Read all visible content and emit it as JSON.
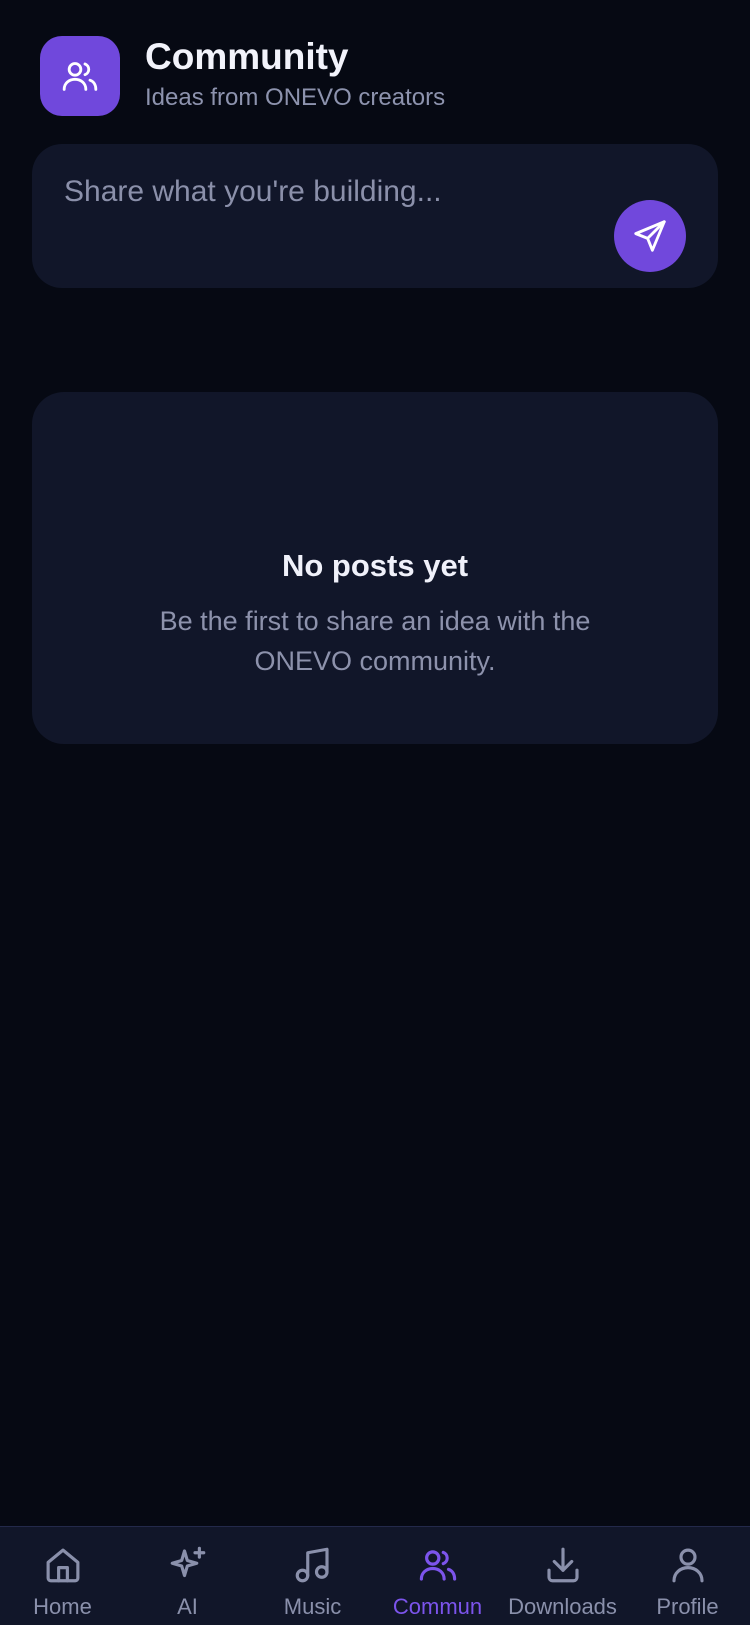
{
  "header": {
    "title": "Community",
    "subtitle": "Ideas from ONEVO creators",
    "icon": "users-icon"
  },
  "composer": {
    "placeholder": "Share what you're building...",
    "value": "",
    "send_icon": "send-icon"
  },
  "empty_state": {
    "title": "No posts yet",
    "description": "Be the first to share an idea with the ONEVO community."
  },
  "bottom_nav": {
    "items": [
      {
        "label": "Home",
        "icon": "home-icon",
        "active": false
      },
      {
        "label": "AI",
        "icon": "sparkles-icon",
        "active": false
      },
      {
        "label": "Music",
        "icon": "music-icon",
        "active": false
      },
      {
        "label": "Commun",
        "icon": "users-icon",
        "active": true
      },
      {
        "label": "Downloads",
        "icon": "download-icon",
        "active": false
      },
      {
        "label": "Profile",
        "icon": "user-icon",
        "active": false
      }
    ]
  },
  "colors": {
    "background": "#060913",
    "card": "#111629",
    "accent": "#7148dc",
    "active_nav": "#7c54ec",
    "muted_text": "#8d92ac"
  }
}
